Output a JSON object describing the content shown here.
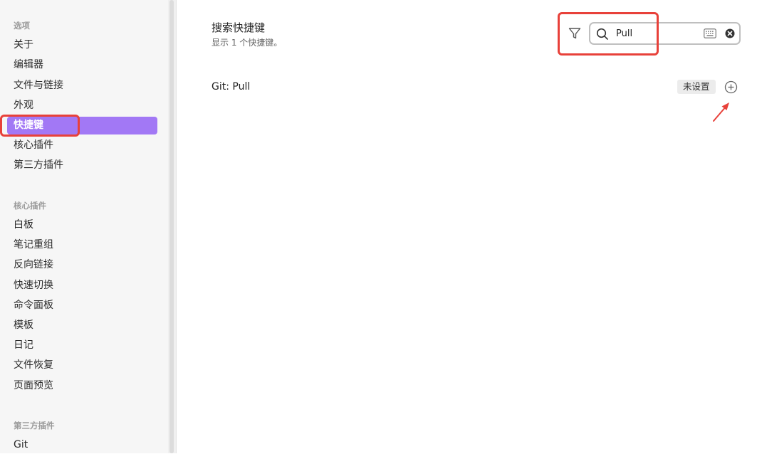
{
  "sidebar": {
    "sections": [
      {
        "title": "选项",
        "items": [
          "关于",
          "编辑器",
          "文件与链接",
          "外观",
          "快捷键",
          "核心插件",
          "第三方插件"
        ]
      },
      {
        "title": "核心插件",
        "items": [
          "白板",
          "笔记重组",
          "反向链接",
          "快速切换",
          "命令面板",
          "模板",
          "日记",
          "文件恢复",
          "页面预览"
        ]
      },
      {
        "title": "第三方插件",
        "items": [
          "Git"
        ]
      }
    ],
    "active_item": "快捷键"
  },
  "main": {
    "title": "搜索快捷键",
    "subtitle": "显示 1 个快捷键。",
    "search": {
      "value": "Pull",
      "placeholder": ""
    },
    "hotkeys": [
      {
        "name": "Git: Pull",
        "status": "未设置"
      }
    ]
  },
  "colors": {
    "accent": "#a278f5",
    "annotation": "#e8413a"
  },
  "icons": {
    "filter": "filter-icon",
    "search": "search-icon",
    "keyboard": "keyboard-icon",
    "clear": "clear-icon",
    "add": "plus-circle-icon"
  }
}
